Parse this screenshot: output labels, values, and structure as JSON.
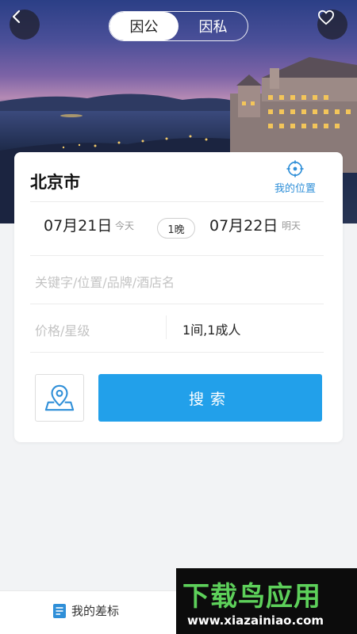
{
  "header": {
    "segment_options": [
      "因公",
      "因私"
    ],
    "active_segment": "因公"
  },
  "search_card": {
    "city": "北京市",
    "my_location_label": "我的位置",
    "checkin": {
      "date": "07月21日",
      "day": "今天"
    },
    "nights": "1晚",
    "checkout": {
      "date": "07月22日",
      "day": "明天"
    },
    "keyword_placeholder": "关键字/位置/品牌/酒店名",
    "price_placeholder": "价格/星级",
    "rooms_guests": "1间,1成人",
    "search_button": "搜索"
  },
  "tabbar": {
    "my_standard_label": "我的差标"
  },
  "watermark": {
    "title": "下载鸟应用",
    "url": "www.xiazainiao.com"
  },
  "colors": {
    "accent": "#22a0ea",
    "link": "#2f8fd8",
    "watermark_green": "#5dd05a"
  }
}
